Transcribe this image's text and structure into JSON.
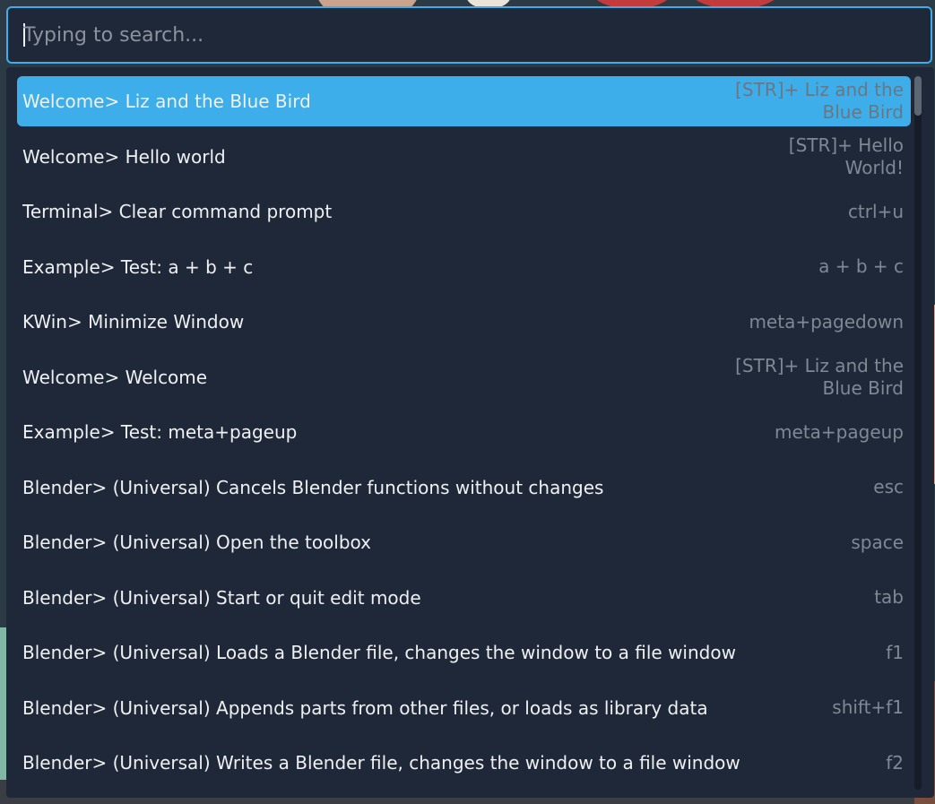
{
  "search": {
    "placeholder": "Typing to search...",
    "value": ""
  },
  "results": [
    {
      "label": "Welcome> Liz and the Blue Bird",
      "shortcut": "[STR]+ Liz and the Blue Bird",
      "selected": true
    },
    {
      "label": "Welcome> Hello world",
      "shortcut": "[STR]+ Hello World!"
    },
    {
      "label": "Terminal> Clear command prompt",
      "shortcut": "ctrl+u"
    },
    {
      "label": "Example> Test: a + b + c",
      "shortcut": "a + b + c"
    },
    {
      "label": "KWin> Minimize Window",
      "shortcut": "meta+pagedown"
    },
    {
      "label": "Welcome> Welcome",
      "shortcut": "[STR]+ Liz and the Blue Bird"
    },
    {
      "label": "Example> Test: meta+pageup",
      "shortcut": "meta+pageup"
    },
    {
      "label": "Blender> (Universal) Cancels Blender functions without changes",
      "shortcut": "esc"
    },
    {
      "label": "Blender> (Universal) Open the toolbox",
      "shortcut": "space"
    },
    {
      "label": "Blender> (Universal) Start or quit edit mode",
      "shortcut": "tab"
    },
    {
      "label": "Blender> (Universal) Loads a Blender file, changes the window to a file window",
      "shortcut": "f1"
    },
    {
      "label": "Blender> (Universal) Appends parts from other files, or loads as library data",
      "shortcut": "shift+f1"
    },
    {
      "label": "Blender> (Universal) Writes a Blender file, changes the window to a file window",
      "shortcut": "f2"
    }
  ],
  "colors": {
    "accent": "#3daee9",
    "panel_bg": "#1f2839",
    "text": "#eff0f1",
    "shortcut_text": "#7f8893"
  }
}
